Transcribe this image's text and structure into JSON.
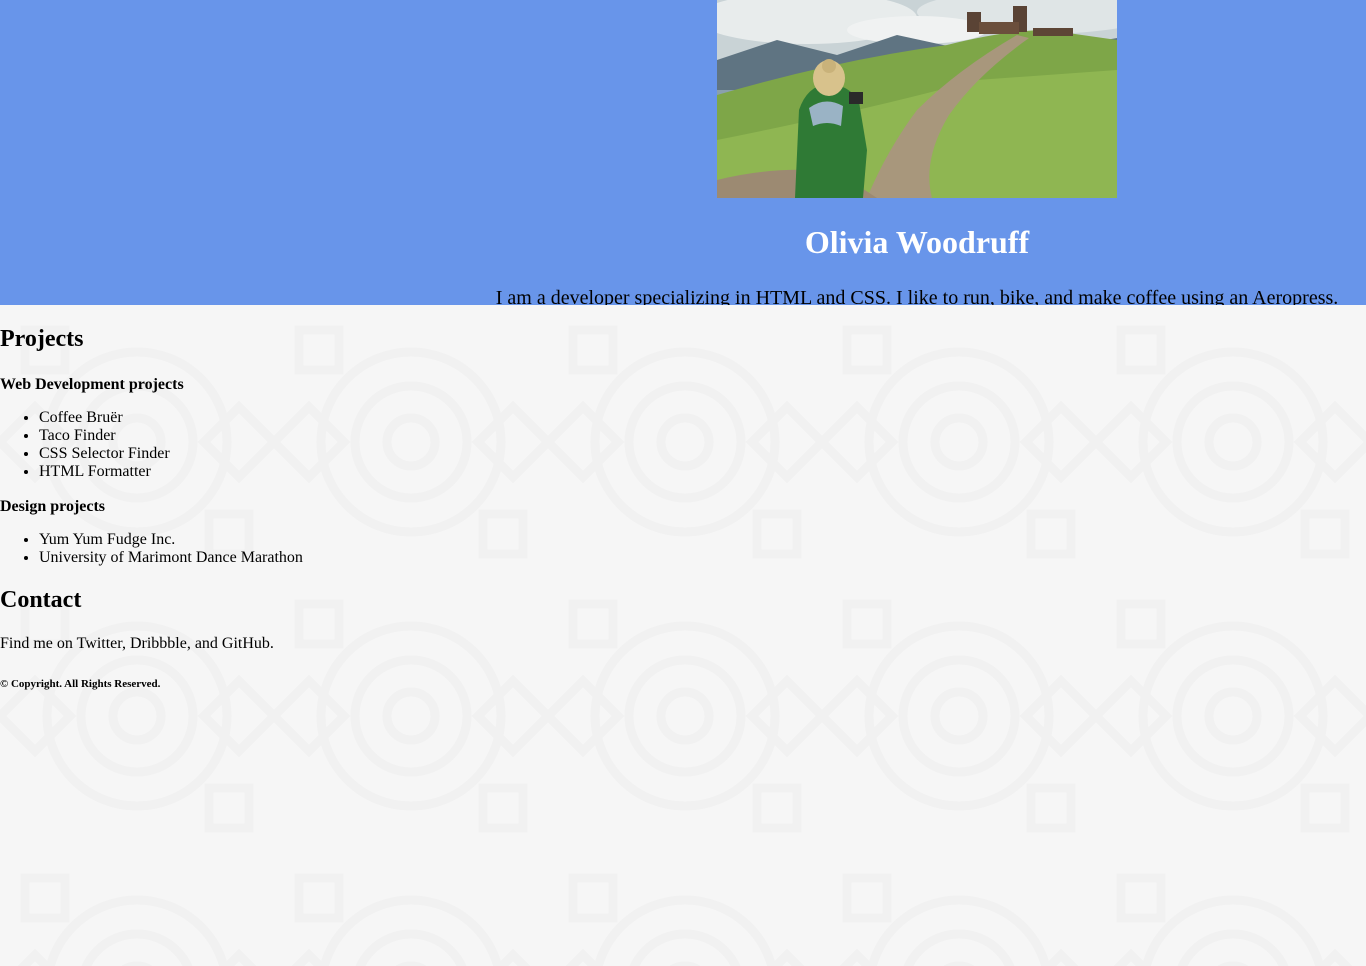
{
  "header": {
    "photo_alt": "Olivia Woodruff photographing a hillside landscape",
    "name": "Olivia Woodruff",
    "tagline": "I am a developer specializing in HTML and CSS. I like to run, bike, and make coffee using an Aeropress."
  },
  "projects": {
    "heading": "Projects",
    "web": {
      "heading": "Web Development projects",
      "items": [
        "Coffee Bruër",
        "Taco Finder",
        "CSS Selector Finder",
        "HTML Formatter"
      ]
    },
    "design": {
      "heading": "Design projects",
      "items": [
        "Yum Yum Fudge Inc.",
        "University of Marimont Dance Marathon"
      ]
    }
  },
  "contact": {
    "heading": "Contact",
    "text": "Find me on Twitter, Dribbble, and GitHub."
  },
  "footer": {
    "copyright": "© Copyright. All Rights Reserved."
  },
  "colors": {
    "header_bg": "#6895ea",
    "page_bg": "#f6f6f6",
    "name_text": "#ffffff"
  }
}
